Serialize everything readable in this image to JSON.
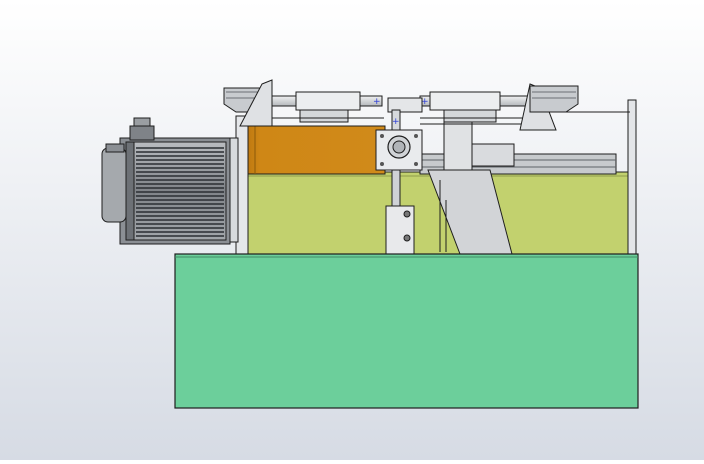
{
  "scene": {
    "type": "cad-assembly-side-view",
    "background": {
      "top": "#ffffff",
      "bottom": "#d6dbe4"
    },
    "colors": {
      "base_block": "#6ccf9b",
      "upper_panel": "#c2d16e",
      "copper_plate": "#cf8716",
      "motor_body": "#909499",
      "motor_dark": "#2b2e33",
      "frame_grey": "#cfd2d6",
      "outline": "#1e1e1e",
      "accent_blue": "#2b3bd6"
    },
    "components": [
      {
        "name": "servo-motor"
      },
      {
        "name": "motor-flange"
      },
      {
        "name": "green-base-block"
      },
      {
        "name": "yellow-side-panel"
      },
      {
        "name": "copper-plate"
      },
      {
        "name": "left-linear-slide-rail"
      },
      {
        "name": "right-linear-slide-rail"
      },
      {
        "name": "center-clamp-assembly"
      },
      {
        "name": "vertical-guide-column"
      },
      {
        "name": "diagonal-support-bracket"
      },
      {
        "name": "right-frame-post"
      },
      {
        "name": "lower-guide-rail"
      }
    ]
  }
}
